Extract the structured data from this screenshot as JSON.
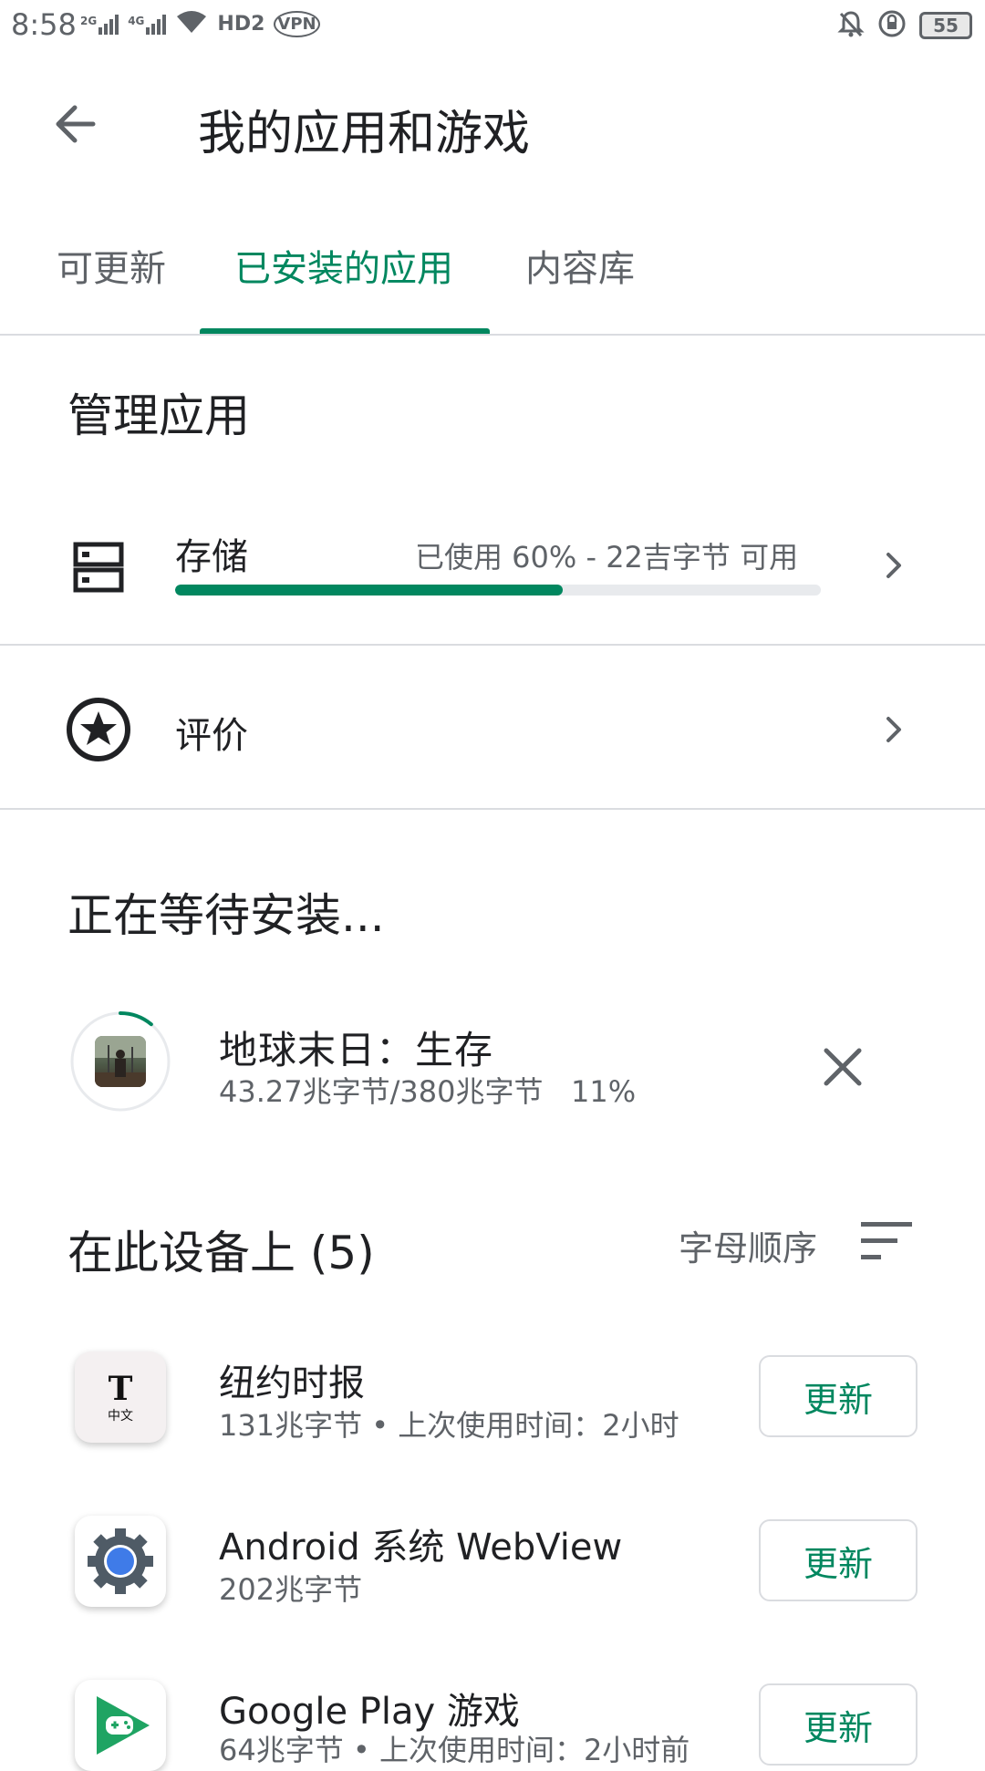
{
  "status_bar": {
    "time": "8:58",
    "net_2g": "2G",
    "net_4g": "4G",
    "hd": "HD2",
    "vpn": "VPN",
    "battery": "55"
  },
  "header": {
    "title": "我的应用和游戏"
  },
  "tabs": [
    {
      "label": "可更新",
      "active": false
    },
    {
      "label": "已安装的应用",
      "active": true
    },
    {
      "label": "内容库",
      "active": false
    }
  ],
  "manage": {
    "heading": "管理应用",
    "storage": {
      "label": "存储",
      "meta": "已使用 60% - 22吉字节 可用",
      "used_fraction": 0.6
    },
    "rating": {
      "label": "评价"
    }
  },
  "pending": {
    "heading": "正在等待安装...",
    "app": {
      "name": "地球末日：生存",
      "meta": "43.27兆字节/380兆字节   11%",
      "progress_fraction": 0.11
    }
  },
  "device": {
    "heading": "在此设备上 (5)",
    "sort_label": "字母顺序",
    "apps": [
      {
        "name": "纽约时报",
        "meta": "131兆字节 • 上次使用时间：2小时",
        "button": "更新",
        "icon": "nyt-icon"
      },
      {
        "name": "Android 系统 WebView",
        "meta": "202兆字节",
        "button": "更新",
        "icon": "webview-gear-icon"
      },
      {
        "name": "Google Play 游戏",
        "meta": "64兆字节 • 上次使用时间：2小时前",
        "button": "更新",
        "icon": "play-games-icon"
      }
    ]
  },
  "colors": {
    "accent": "#01875f",
    "text": "#202124",
    "secondary": "#5f6368",
    "divider": "#dadce0"
  }
}
